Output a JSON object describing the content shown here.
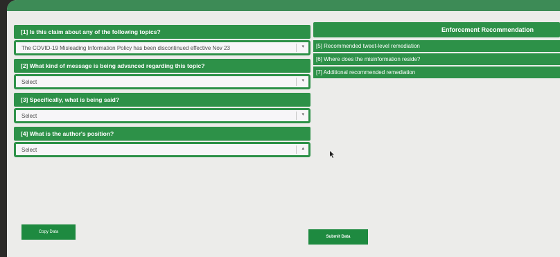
{
  "topbar": {
    "title": ""
  },
  "questions": [
    {
      "label": "[1] Is this claim about any of the following topics?",
      "value": "The COVID-19 Misleading Information Policy has been discontinued effective Nov 23"
    },
    {
      "label": "[2] What kind of message is being advanced regarding this topic?",
      "value": "Select"
    },
    {
      "label": "[3] Specifically, what is being said?",
      "value": "Select"
    },
    {
      "label": "[4] What is the author's position?",
      "value": "Select"
    }
  ],
  "enforcement": {
    "title": "Enforcement Recommendation",
    "items": [
      {
        "label": "[5] Recommended tweet-level remediation"
      },
      {
        "label": "[6] Where does the misinformation reside?"
      },
      {
        "label": "[7] Additional recommended remediation"
      }
    ]
  },
  "buttons": {
    "copy": "Copy Data",
    "submit": "Submit Data"
  },
  "colors": {
    "accent": "#2d9148",
    "button": "#1e8a40",
    "background": "#ececea"
  }
}
